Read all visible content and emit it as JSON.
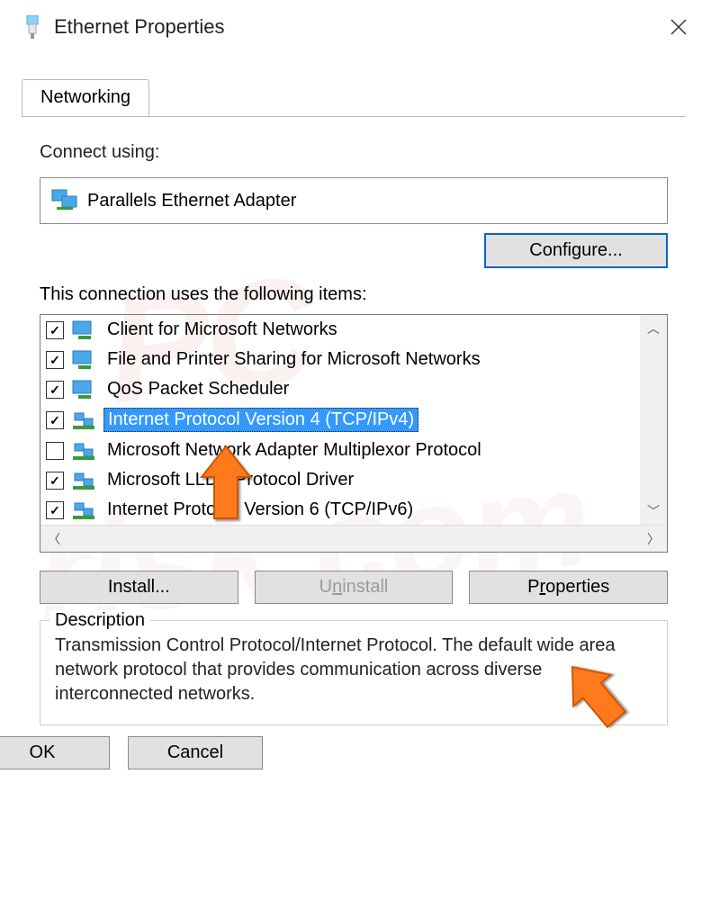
{
  "title": "Ethernet Properties",
  "tab": {
    "label": "Networking"
  },
  "connect_using_label": "Connect using:",
  "adapter_name": "Parallels Ethernet Adapter",
  "buttons": {
    "configure": "Configure...",
    "install": "Install...",
    "uninstall_pre": "U",
    "uninstall_mid": "n",
    "uninstall_post": "install",
    "properties_pre": "P",
    "properties_mid": "r",
    "properties_post": "operties",
    "ok": "OK",
    "cancel": "Cancel"
  },
  "items_label": "This connection uses the following items:",
  "items": [
    {
      "checked": true,
      "icon": "monitor",
      "label": "Client for Microsoft Networks",
      "selected": false
    },
    {
      "checked": true,
      "icon": "monitor",
      "label": "File and Printer Sharing for Microsoft Networks",
      "selected": false
    },
    {
      "checked": true,
      "icon": "monitor",
      "label": "QoS Packet Scheduler",
      "selected": false
    },
    {
      "checked": true,
      "icon": "net",
      "label": "Internet Protocol Version 4 (TCP/IPv4)",
      "selected": true
    },
    {
      "checked": false,
      "icon": "net",
      "label": "Microsoft Network Adapter Multiplexor Protocol",
      "selected": false
    },
    {
      "checked": true,
      "icon": "net",
      "label": "Microsoft LLDP Protocol Driver",
      "selected": false
    },
    {
      "checked": true,
      "icon": "net",
      "label": "Internet Protocol Version 6 (TCP/IPv6)",
      "selected": false
    }
  ],
  "description": {
    "label": "Description",
    "text": "Transmission Control Protocol/Internet Protocol. The default wide area network protocol that provides communication across diverse interconnected networks."
  }
}
